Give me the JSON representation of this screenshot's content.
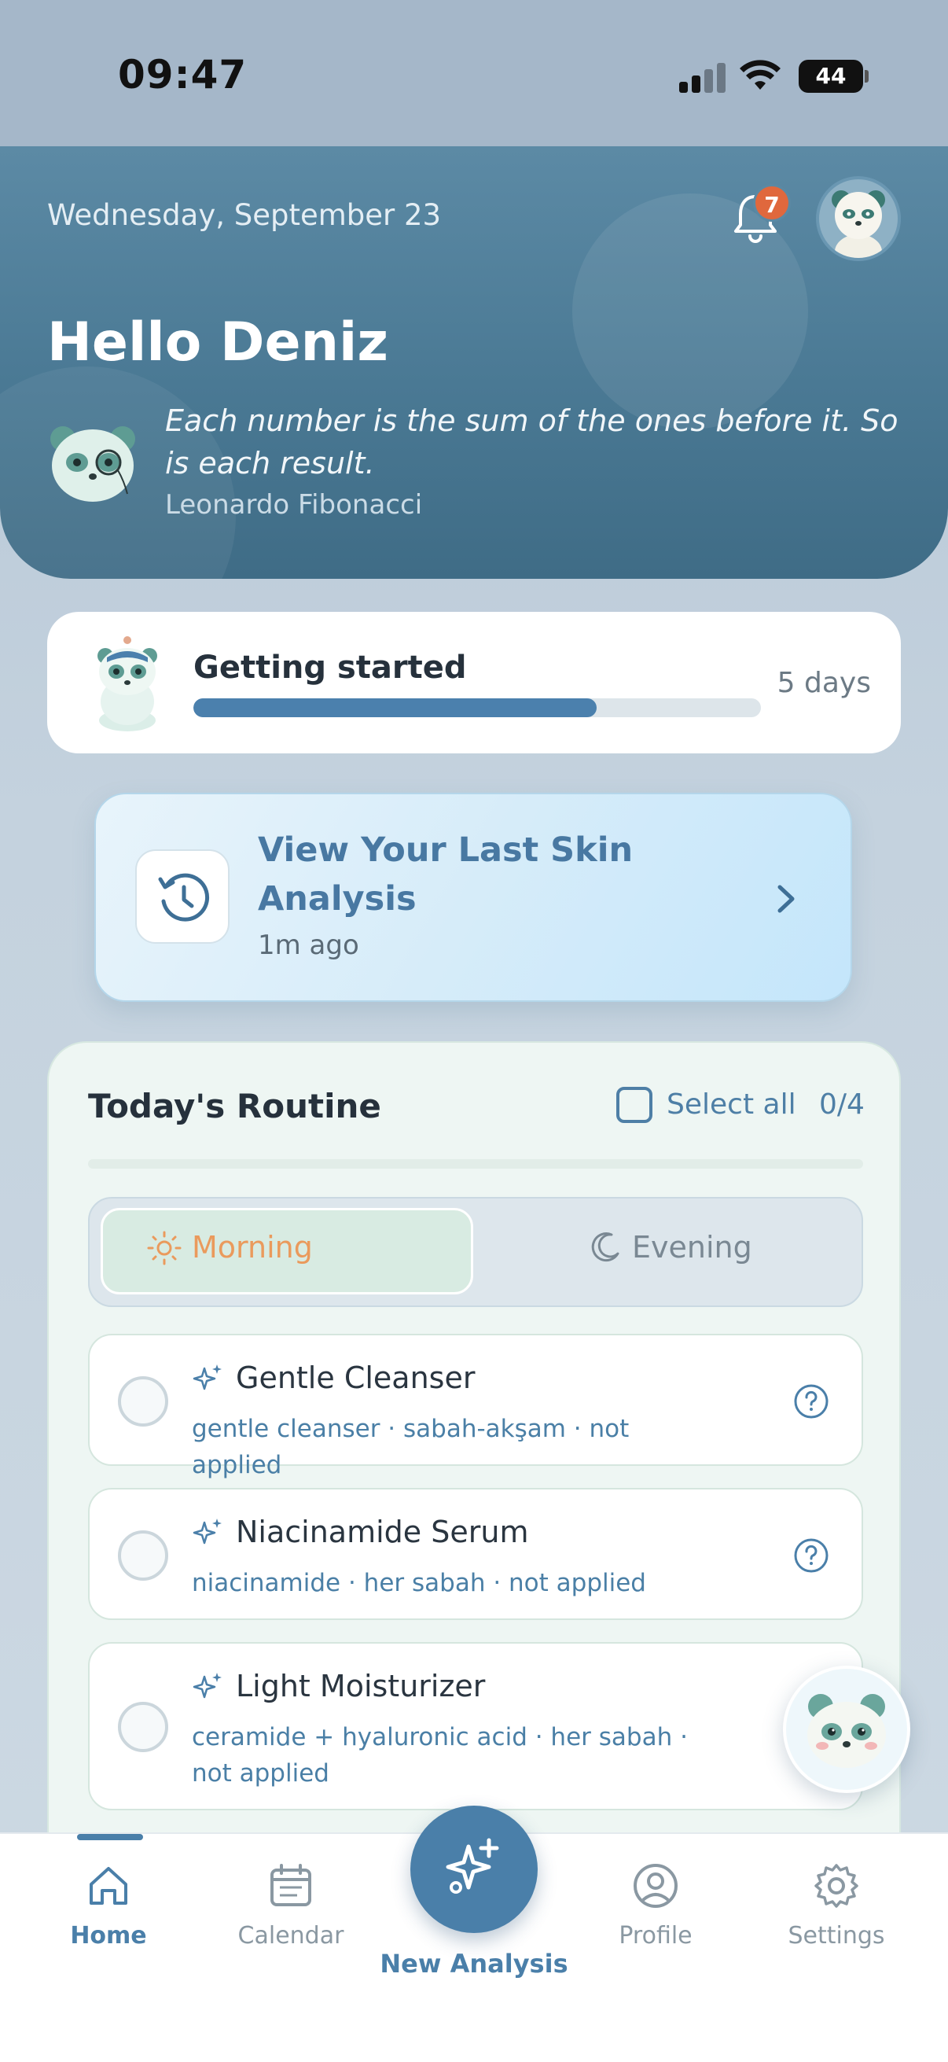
{
  "status_bar": {
    "time": "09:47",
    "battery": "44"
  },
  "header": {
    "date": "Wednesday, September 23",
    "notification_count": "7",
    "greeting": "Hello Deniz",
    "quote": "Each number is the sum of the ones before it. So is each result.",
    "quote_author": "Leonardo Fibonacci"
  },
  "getting_started": {
    "title": "Getting started",
    "progress": 0.71,
    "days": "5 days"
  },
  "last_analysis": {
    "title": "View Your Last Skin Analysis",
    "subtitle": "1m ago",
    "icon": "history-icon"
  },
  "routine": {
    "title": "Today's Routine",
    "select_all": "Select all",
    "count": "0/4",
    "tabs": {
      "morning": "Morning",
      "evening": "Evening",
      "active": "morning"
    },
    "items": [
      {
        "name": "Gentle Cleanser",
        "meta": "gentle cleanser · sabah-akşam · not applied"
      },
      {
        "name": "Niacinamide Serum",
        "meta": "niacinamide · her sabah · not applied"
      },
      {
        "name": "Light Moisturizer",
        "meta": "ceramide + hyaluronic acid · her sabah · not applied"
      }
    ]
  },
  "nav": {
    "home": "Home",
    "calendar": "Calendar",
    "new_analysis": "New Analysis",
    "profile": "Profile",
    "settings": "Settings",
    "active": "home"
  },
  "colors": {
    "accent": "#4a7fa9",
    "header": "#4a7994",
    "badge": "#e0683d",
    "morning": "#ea9a5c"
  }
}
